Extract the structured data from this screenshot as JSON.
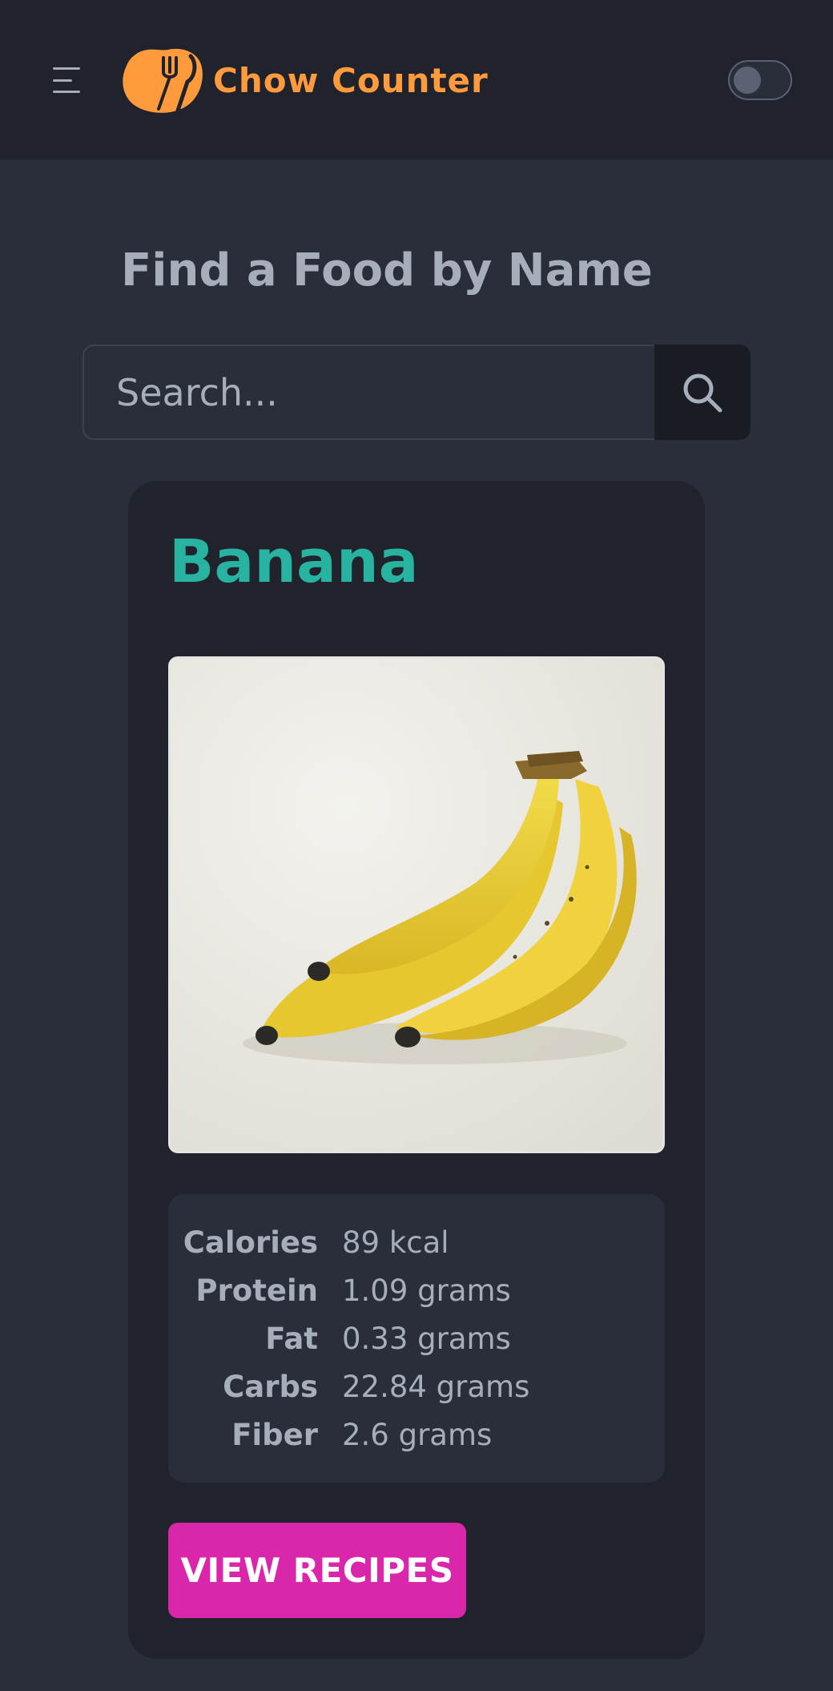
{
  "navbar": {
    "app_name": "Chow Counter",
    "theme_toggle": "off",
    "colors": {
      "brand": "#ff9a3d",
      "background": "#20232c"
    }
  },
  "main": {
    "heading": "Find a Food by Name",
    "search": {
      "placeholder": "Search...",
      "value": "",
      "icon": "search-icon"
    }
  },
  "food": {
    "name": "Banana",
    "image_alt": "Banana",
    "nutrition": [
      {
        "label": "Calories",
        "value": "89 kcal"
      },
      {
        "label": "Protein",
        "value": "1.09 grams"
      },
      {
        "label": "Fat",
        "value": "0.33 grams"
      },
      {
        "label": "Carbs",
        "value": "22.84 grams"
      },
      {
        "label": "Fiber",
        "value": "2.6 grams"
      }
    ],
    "recipes_button": "VIEW RECIPES",
    "colors": {
      "name": "#27b3a0",
      "button": "#d926aa"
    }
  }
}
